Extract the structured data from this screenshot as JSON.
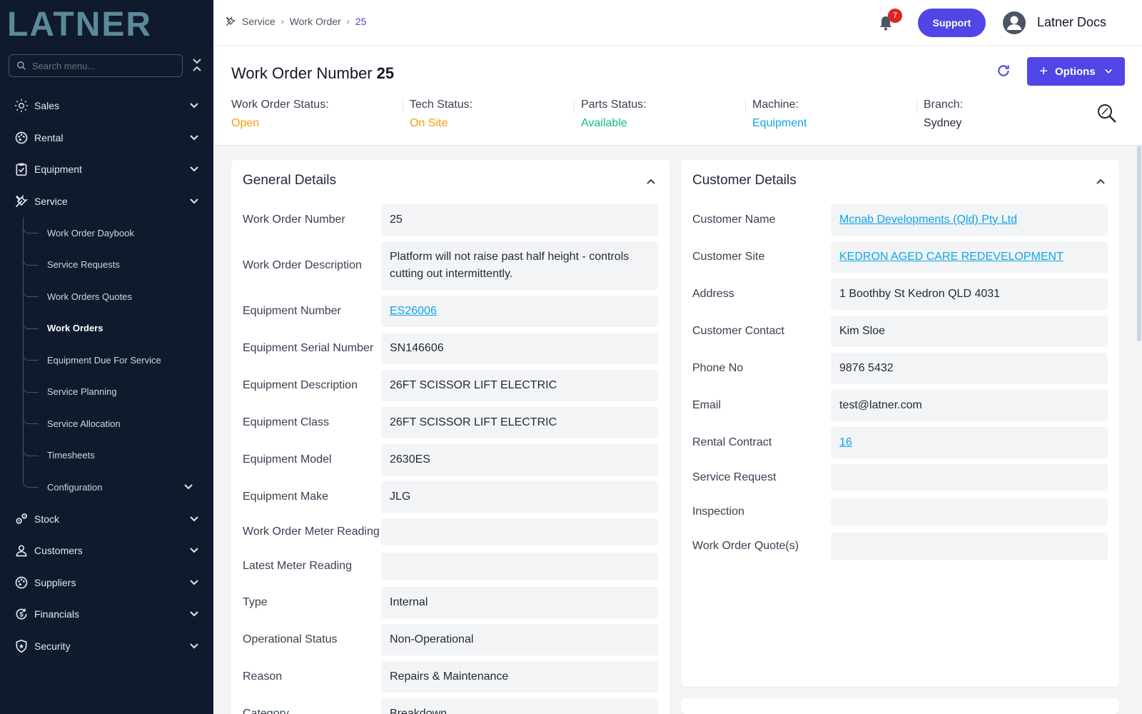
{
  "brand": {
    "logo_text": "LATNER"
  },
  "sidebar": {
    "search_placeholder": "Search menu...",
    "items": [
      {
        "label": "Sales",
        "icon": "sun-icon"
      },
      {
        "label": "Rental",
        "icon": "palette-icon"
      },
      {
        "label": "Equipment",
        "icon": "clipboard-check-icon"
      },
      {
        "label": "Service",
        "icon": "tools-icon"
      }
    ],
    "service_sub": [
      {
        "label": "Work Order Daybook"
      },
      {
        "label": "Service Requests"
      },
      {
        "label": "Work Orders Quotes"
      },
      {
        "label": "Work Orders"
      },
      {
        "label": "Equipment Due For Service"
      },
      {
        "label": "Service Planning"
      },
      {
        "label": "Service Allocation"
      },
      {
        "label": "Timesheets"
      },
      {
        "label": "Configuration"
      }
    ],
    "items_after": [
      {
        "label": "Stock",
        "icon": "gears-icon"
      },
      {
        "label": "Customers",
        "icon": "user-icon"
      },
      {
        "label": "Suppliers",
        "icon": "palette-icon"
      },
      {
        "label": "Financials",
        "icon": "dollar-cycle-icon"
      },
      {
        "label": "Security",
        "icon": "shield-icon"
      }
    ],
    "colors": {
      "bg": "#0f1b2d",
      "logo": "#5b8a99"
    }
  },
  "breadcrumb": {
    "items": [
      "Service",
      "Work Order"
    ],
    "current": "25"
  },
  "topbar": {
    "notification_count": "7",
    "support_label": "Support",
    "user_name": "Latner Docs",
    "accent": "#4f46e5"
  },
  "header": {
    "title_label": "Work Order Number",
    "title_value": "25",
    "options_label": "Options",
    "stats": [
      {
        "label": "Work Order Status:",
        "value": "Open",
        "color": "#f59e0b"
      },
      {
        "label": "Tech Status:",
        "value": "On Site",
        "color": "#f59e0b"
      },
      {
        "label": "Parts Status:",
        "value": "Available",
        "color": "#10b981"
      },
      {
        "label": "Machine:",
        "value": "Equipment",
        "color": "#0ea5e9"
      },
      {
        "label": "Branch:",
        "value": "Sydney",
        "color": "#1f2937"
      }
    ]
  },
  "general": {
    "title": "General Details",
    "rows": [
      {
        "label": "Work Order Number",
        "value": "25"
      },
      {
        "label": "Work Order Description",
        "value": "Platform will not raise past half height - controls cutting out intermittently."
      },
      {
        "label": "Equipment Number",
        "value": "ES26006",
        "link": true
      },
      {
        "label": "Equipment Serial Number",
        "value": "SN146606"
      },
      {
        "label": "Equipment Description",
        "value": "26FT SCISSOR LIFT ELECTRIC"
      },
      {
        "label": "Equipment Class",
        "value": "26FT SCISSOR LIFT ELECTRIC"
      },
      {
        "label": "Equipment Model",
        "value": "2630ES"
      },
      {
        "label": "Equipment Make",
        "value": "JLG"
      },
      {
        "label": "Work Order Meter Reading",
        "value": ""
      },
      {
        "label": "Latest Meter Reading",
        "value": ""
      },
      {
        "label": "Type",
        "value": "Internal"
      },
      {
        "label": "Operational Status",
        "value": "Non-Operational"
      },
      {
        "label": "Reason",
        "value": "Repairs & Maintenance"
      },
      {
        "label": "Category",
        "value": "Breakdown"
      }
    ]
  },
  "customer": {
    "title": "Customer Details",
    "rows": [
      {
        "label": "Customer Name",
        "value": "Mcnab Developments (Qld) Pty Ltd",
        "link": true
      },
      {
        "label": "Customer Site",
        "value": "KEDRON AGED CARE REDEVELOPMENT",
        "link": true
      },
      {
        "label": "Address",
        "value": "1 Boothby St Kedron QLD 4031"
      },
      {
        "label": "Customer Contact",
        "value": "Kim Sloe"
      },
      {
        "label": "Phone No",
        "value": "9876 5432"
      },
      {
        "label": "Email",
        "value": "test@latner.com"
      },
      {
        "label": "Rental Contract",
        "value": "16",
        "link": true
      },
      {
        "label": "Service Request",
        "value": ""
      },
      {
        "label": "Inspection",
        "value": ""
      },
      {
        "label": "Work Order Quote(s)",
        "value": ""
      }
    ]
  }
}
